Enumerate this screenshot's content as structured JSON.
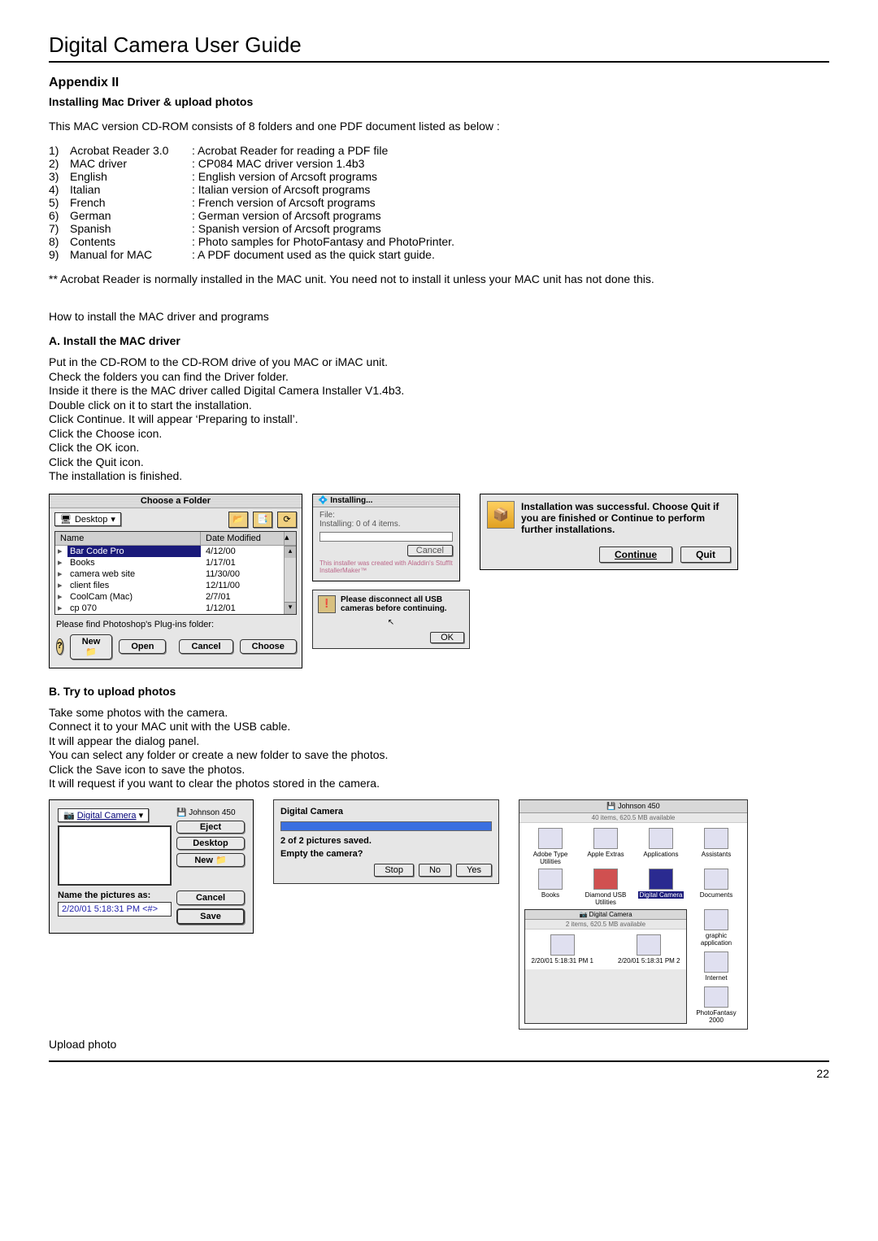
{
  "header": {
    "title": "Digital Camera User Guide"
  },
  "appendix": {
    "heading": "Appendix II",
    "sub": "Installing Mac Driver & upload photos",
    "intro": "This MAC version CD-ROM consists of 8 folders and one PDF document listed as below :",
    "folders": [
      {
        "num": "1)",
        "name": "Acrobat Reader 3.0",
        "desc": ": Acrobat Reader for reading a PDF file"
      },
      {
        "num": "2)",
        "name": "MAC driver",
        "desc": ": CP084 MAC driver version 1.4b3"
      },
      {
        "num": "3)",
        "name": "English",
        "desc": ": English version of Arcsoft programs"
      },
      {
        "num": "4)",
        "name": "Italian",
        "desc": ": Italian version of Arcsoft programs"
      },
      {
        "num": "5)",
        "name": "French",
        "desc": ": French version of Arcsoft programs"
      },
      {
        "num": "6)",
        "name": "German",
        "desc": ": German version of Arcsoft programs"
      },
      {
        "num": "7)",
        "name": "Spanish",
        "desc": ": Spanish version of Arcsoft programs"
      },
      {
        "num": "8)",
        "name": "Contents",
        "desc": ": Photo samples for PhotoFantasy and PhotoPrinter."
      },
      {
        "num": "9)",
        "name": "Manual for MAC",
        "desc": ": A PDF document used as the quick start guide."
      }
    ],
    "note": "** Acrobat Reader is normally installed in the MAC unit. You need not to install it unless your MAC unit has not done this.",
    "howto": "How to install the MAC driver and programs"
  },
  "sectionA": {
    "heading": "A.   Install the MAC driver",
    "steps": [
      "Put in the CD-ROM to the CD-ROM drive of you MAC or iMAC unit.",
      "Check the folders you can find the Driver folder.",
      "Inside it there is the MAC driver called Digital Camera Installer V1.4b3.",
      "Double click on it to start the installation.",
      "Click Continue. It will appear ‘Preparing to install’.",
      "Click the Choose icon.",
      "Click the OK icon.",
      "Click the Quit icon.",
      "The installation is finished."
    ]
  },
  "chooseFolder": {
    "title": "Choose a Folder",
    "dropdown": "Desktop",
    "colName": "Name",
    "colDate": "Date Modified",
    "rows": [
      {
        "name": "Bar Code Pro",
        "date": "4/12/00",
        "selected": true
      },
      {
        "name": "Books",
        "date": "1/17/01"
      },
      {
        "name": "camera web site",
        "date": "11/30/00"
      },
      {
        "name": "client files",
        "date": "12/11/00"
      },
      {
        "name": "CoolCam (Mac)",
        "date": "2/7/01"
      },
      {
        "name": "cp 070",
        "date": "1/12/01"
      }
    ],
    "footerLabel": "Please find Photoshop's Plug-ins  folder:",
    "buttons": {
      "new": "New 📁",
      "open": "Open",
      "cancel": "Cancel",
      "choose": "Choose"
    }
  },
  "installing": {
    "title": "Installing...",
    "fileLabel": "File:",
    "status": "Installing: 0 of 4 items.",
    "cancel": "Cancel",
    "note": "This installer was created with Aladdin's StuffIt InstallerMaker™"
  },
  "disconnect": {
    "text": "Please disconnect all USB cameras before continuing.",
    "ok": "OK"
  },
  "success": {
    "text": "Installation was successful.  Choose Quit if you are finished or Continue to perform further installations.",
    "continue": "Continue",
    "quit": "Quit"
  },
  "sectionB": {
    "heading": "B.   Try to upload photos",
    "steps": [
      "Take some photos with the camera.",
      "Connect it to your MAC unit with the USB cable.",
      "It will appear the dialog panel.",
      "You can select any folder or create a new folder to save the photos.",
      "Click the Save icon to save the photos.",
      "It will request if you want to clear the photos stored in the camera."
    ]
  },
  "saveDialog": {
    "dropdown": "Digital Camera",
    "diskLabel": "Johnson 450",
    "eject": "Eject",
    "desktop": "Desktop",
    "new": "New 📁",
    "cancel": "Cancel",
    "save": "Save",
    "nameLabel": "Name the pictures as:",
    "nameValue": "2/20/01 5:18:31 PM <#>"
  },
  "clearDialog": {
    "title": "Digital Camera",
    "status": "2 of 2 pictures saved.",
    "question": "Empty the camera?",
    "stop": "Stop",
    "no": "No",
    "yes": "Yes"
  },
  "finder": {
    "title": "Johnson 450",
    "sub": "40 items, 620.5 MB available",
    "items": [
      "Adobe Type Utilities",
      "Apple Extras",
      "Applications",
      "Assistants",
      "Books",
      "Diamond USB Utilities",
      "Digital Camera",
      "Documents"
    ],
    "nestedTitle": "Digital Camera",
    "nestedSub": "2 items, 620.5 MB available",
    "nestedItems": [
      "2/20/01 5:18:31 PM  1",
      "2/20/01 5:18:31 PM  2"
    ],
    "sideItems": [
      "graphic application",
      "Internet",
      "PhotoFantasy 2000"
    ]
  },
  "uploadCaption": "Upload photo",
  "pageNumber": "22"
}
